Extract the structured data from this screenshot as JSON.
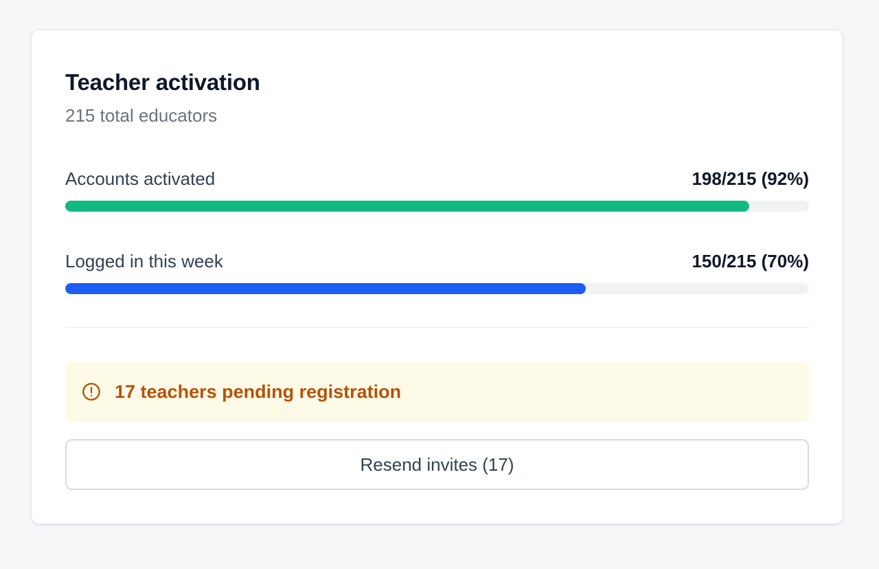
{
  "card": {
    "title": "Teacher activation",
    "subtitle": "215 total educators"
  },
  "metrics": [
    {
      "label": "Accounts activated",
      "value_text": "198/215 (92%)",
      "fraction": 0.92,
      "color": "#12b981"
    },
    {
      "label": "Logged in this week",
      "value_text": "150/215 (70%)",
      "fraction": 0.7,
      "color": "#1d5cf5"
    }
  ],
  "alert": {
    "icon": "alert-circle-icon",
    "text": "17 teachers pending registration",
    "color": "#b45309",
    "background": "#fefae8"
  },
  "actions": {
    "resend_label": "Resend invites (17)"
  }
}
